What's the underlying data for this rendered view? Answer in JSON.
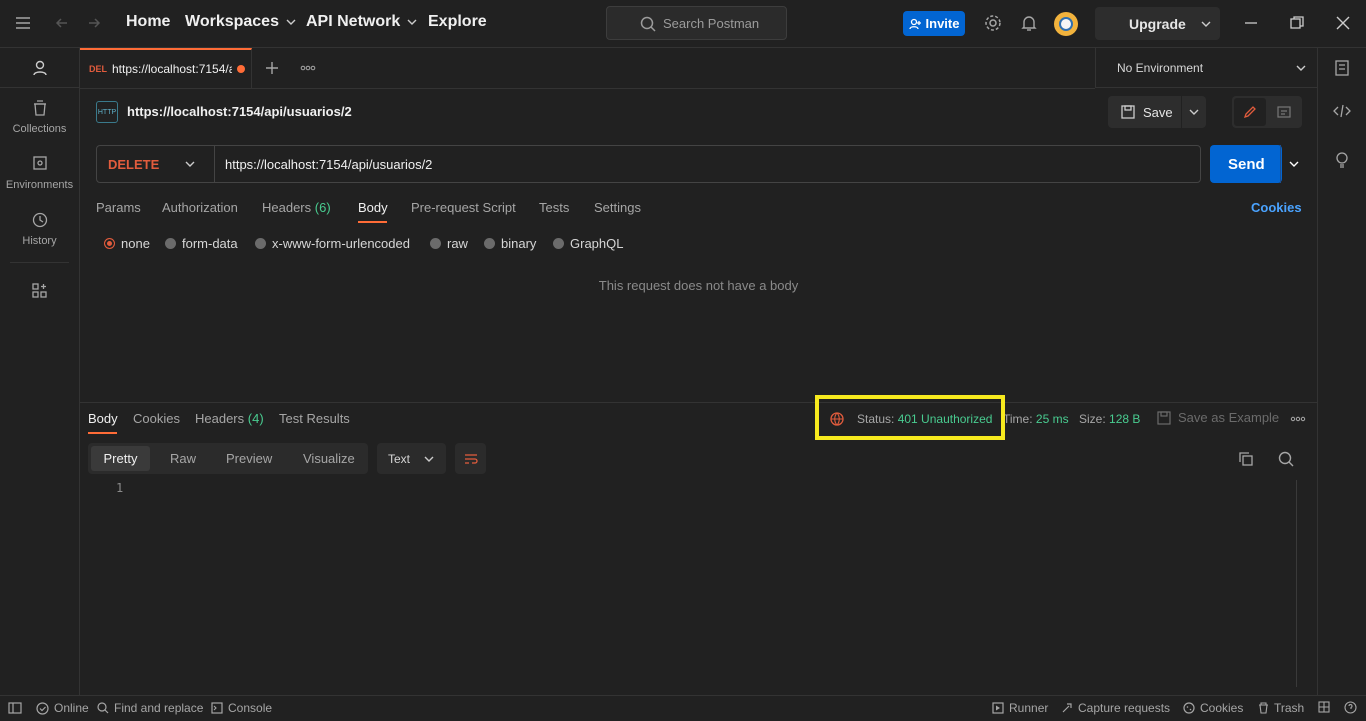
{
  "nav": {
    "home": "Home",
    "workspaces": "Workspaces",
    "api_network": "API Network",
    "explore": "Explore",
    "search_placeholder": "Search Postman",
    "invite": "Invite",
    "upgrade": "Upgrade"
  },
  "sidebar": {
    "items": [
      {
        "label": "Collections",
        "icon": "collections-icon"
      },
      {
        "label": "Environments",
        "icon": "environments-icon"
      },
      {
        "label": "History",
        "icon": "history-icon"
      }
    ]
  },
  "tab": {
    "method": "DEL",
    "title": "https://localhost:7154/a"
  },
  "environment": "No Environment",
  "request": {
    "name": "https://localhost:7154/api/usuarios/2",
    "method": "DELETE",
    "url": "https://localhost:7154/api/usuarios/2",
    "save": "Save",
    "send": "Send"
  },
  "req_tabs": {
    "params": "Params",
    "authorization": "Authorization",
    "headers": "Headers",
    "headers_count": "(6)",
    "body": "Body",
    "prerequest": "Pre-request Script",
    "tests": "Tests",
    "settings": "Settings",
    "cookies": "Cookies"
  },
  "body_types": [
    "none",
    "form-data",
    "x-www-form-urlencoded",
    "raw",
    "binary",
    "GraphQL"
  ],
  "body_empty": "This request does not have a body",
  "response": {
    "tabs": {
      "body": "Body",
      "cookies": "Cookies",
      "headers": "Headers",
      "headers_count": "(4)",
      "tests": "Test Results"
    },
    "status_label": "Status:",
    "status_value": "401 Unauthorized",
    "time_label": "Time:",
    "time_value": "25 ms",
    "size_label": "Size:",
    "size_value": "128 B",
    "save_example": "Save as Example",
    "formats": [
      "Pretty",
      "Raw",
      "Preview",
      "Visualize"
    ],
    "lang": "Text",
    "line_number": "1"
  },
  "statusbar": {
    "online": "Online",
    "find": "Find and replace",
    "console": "Console",
    "runner": "Runner",
    "capture": "Capture requests",
    "cookies": "Cookies",
    "trash": "Trash"
  },
  "colors": {
    "accent": "#ff6c37",
    "primary": "#0265d2",
    "success": "#49cc90",
    "error": "#e25c3d",
    "highlight": "#f7ea1e"
  }
}
